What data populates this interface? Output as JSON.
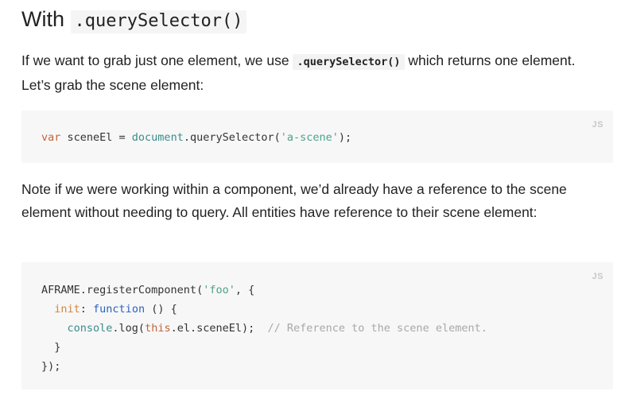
{
  "heading": {
    "prefix": "With ",
    "code": ".querySelector()"
  },
  "para1": {
    "before": "If we want to grab just one element, we use ",
    "code": ".querySelector()",
    "after": " which returns one element. Let’s grab the scene element:"
  },
  "code1": {
    "lang": "JS",
    "tokens": {
      "var": "var",
      "name": " sceneEl = ",
      "document": "document",
      "call": ".querySelector(",
      "arg": "'a-scene'",
      "end": ");"
    }
  },
  "para2": {
    "text": "Note if we were working within a component, we’d already have a reference to the scene element without needing to query. All entities have reference to their scene element:"
  },
  "code2": {
    "lang": "JS",
    "line1": {
      "a": "AFRAME.registerComponent(",
      "str": "'foo'",
      "b": ", {"
    },
    "line2": {
      "indent": "  ",
      "init": "init",
      "colon": ": ",
      "function": "function",
      "rest": " () {"
    },
    "line3": {
      "indent": "    ",
      "console": "console",
      "log": ".log(",
      "this": "this",
      "rest": ".el.sceneEl);  ",
      "comment": "// Reference to the scene element."
    },
    "line4": "  }",
    "line5": "});"
  }
}
